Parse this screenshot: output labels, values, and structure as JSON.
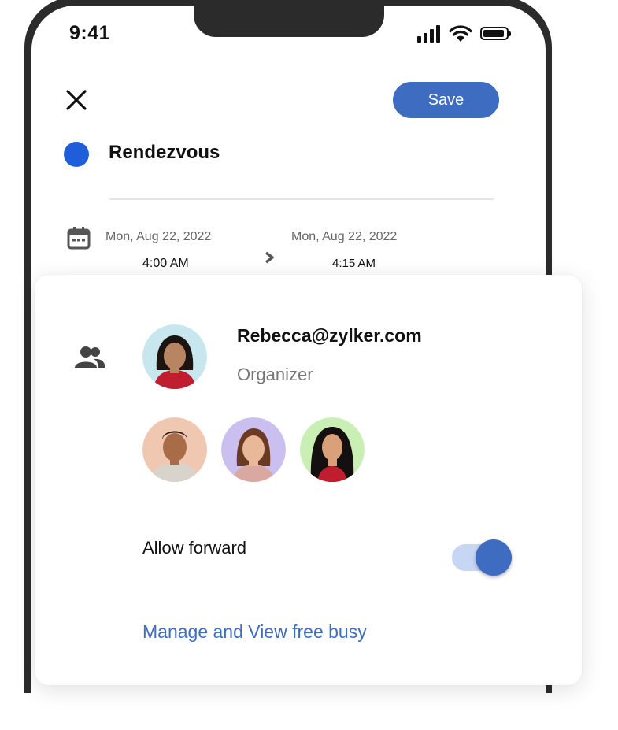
{
  "status_bar": {
    "time": "9:41"
  },
  "header": {
    "save_label": "Save"
  },
  "event": {
    "title": "Rendezvous",
    "color": "#1e5fd9"
  },
  "schedule": {
    "start_date": "Mon, Aug 22, 2022",
    "start_time": "4:00 AM",
    "end_date": "Mon, Aug 22, 2022",
    "end_time": "4:15 AM"
  },
  "attendees": {
    "organizer": {
      "email": "Rebecca@zylker.com",
      "role": "Organizer",
      "avatar_bg": "#c7e6ee"
    },
    "guests": [
      {
        "avatar_bg": "#f0c7b0"
      },
      {
        "avatar_bg": "#cbbff0"
      },
      {
        "avatar_bg": "#c9efb5"
      }
    ]
  },
  "allow_forward": {
    "label": "Allow forward",
    "enabled": true
  },
  "free_busy_link": "Manage and View free busy",
  "colors": {
    "accent": "#3d6cc0",
    "frame": "#2b2b2b"
  }
}
